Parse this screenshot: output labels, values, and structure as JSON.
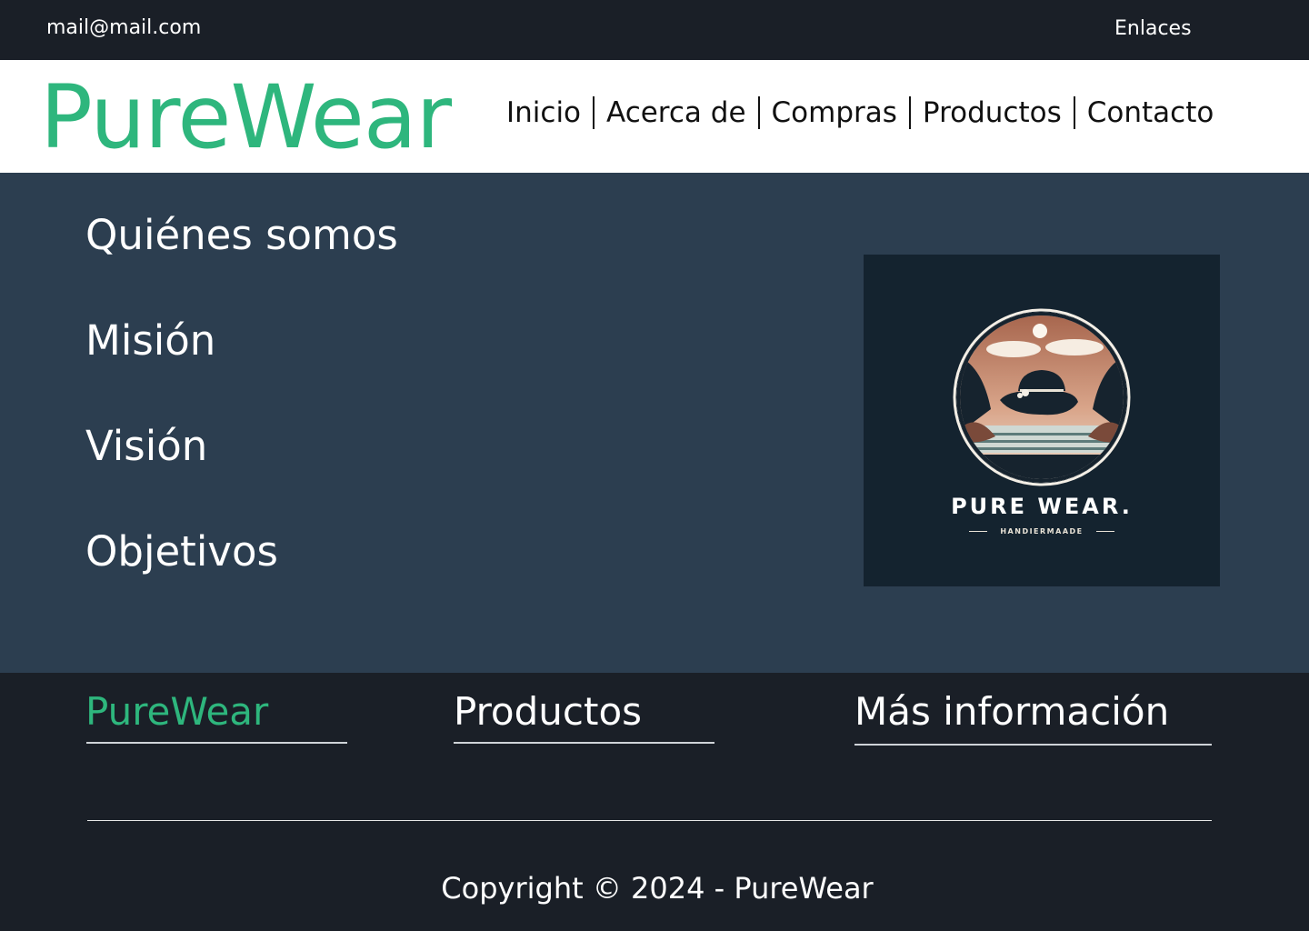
{
  "topbar": {
    "email": "mail@mail.com",
    "links_label": "Enlaces"
  },
  "header": {
    "brand": "PureWear",
    "nav": [
      "Inicio",
      "Acerca de",
      "Compras",
      "Productos",
      "Contacto"
    ]
  },
  "main": {
    "sections": [
      "Quiénes somos",
      "Misión",
      "Visión",
      "Objetivos"
    ],
    "logo": {
      "title": "PURE WEAR.",
      "subtitle": "HANDIERMAADE"
    }
  },
  "footer": {
    "columns": [
      "PureWear",
      "Productos",
      "Más información"
    ],
    "copyright": "Copyright © 2024 - PureWear"
  },
  "colors": {
    "accent": "#2eb67d",
    "dark": "#1a1f27",
    "main_bg": "#2c3e50",
    "logo_bg": "#14232f"
  }
}
